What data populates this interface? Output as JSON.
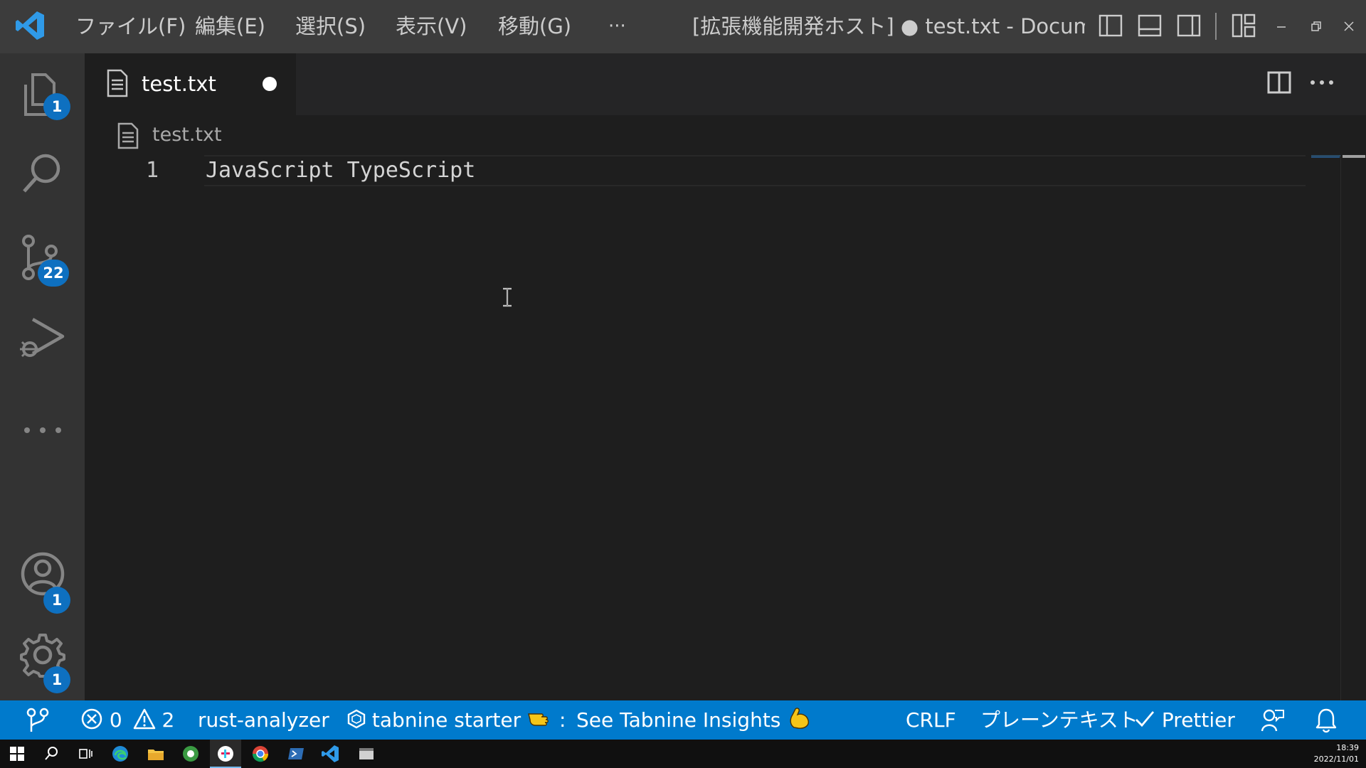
{
  "titlebar": {
    "menus": [
      "ファイル(F)",
      "編集(E)",
      "選択(S)",
      "表示(V)",
      "移動(G)"
    ],
    "more_label": "···",
    "window_title": "[拡張機能開発ホスト] ● test.txt - Docume...",
    "icons": [
      "vscode-logo-icon",
      "toggle-primary-sidebar-icon",
      "toggle-panel-icon",
      "toggle-secondary-sidebar-icon",
      "customize-layout-icon",
      "minimize-icon",
      "restore-icon",
      "close-icon"
    ]
  },
  "activitybar": {
    "explorer_badge": "1",
    "scm_badge": "22",
    "accounts_badge": "1",
    "settings_badge": "1"
  },
  "tab": {
    "label": "test.txt",
    "dirty": true
  },
  "breadcrumb": {
    "file": "test.txt"
  },
  "editor": {
    "lines": [
      {
        "number": "1",
        "text": "JavaScript TypeScript"
      }
    ]
  },
  "statusbar": {
    "errors": "0",
    "warnings": "2",
    "rust": "rust-analyzer",
    "tabnine": "tabnine starter",
    "tabnine_suffix": ":",
    "insights": "See Tabnine Insights",
    "eol": "CRLF",
    "language": "プレーンテキスト",
    "prettier": "Prettier"
  },
  "taskbar": {
    "time": "18:39",
    "date": "2022/11/01"
  },
  "colors": {
    "statusbar": "#007acc",
    "badge": "#0e70c0",
    "titlebar": "#3c3c3c",
    "activitybar": "#333333",
    "editor": "#1e1e1e"
  }
}
